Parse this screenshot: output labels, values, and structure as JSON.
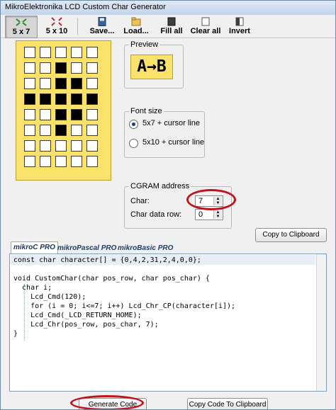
{
  "window": {
    "title": "MikroElektronika LCD Custom Char Generator"
  },
  "toolbar": {
    "size_5x7": "5 x 7",
    "size_5x10": "5 x 10",
    "save": "Save...",
    "load": "Load...",
    "fill_all": "Fill all",
    "clear_all": "Clear all",
    "invert": "Invert"
  },
  "grid": {
    "rows": 8,
    "cols": 5,
    "on_cells": [
      [
        1,
        2
      ],
      [
        2,
        2
      ],
      [
        2,
        3
      ],
      [
        3,
        0
      ],
      [
        3,
        1
      ],
      [
        3,
        2
      ],
      [
        3,
        3
      ],
      [
        3,
        4
      ],
      [
        4,
        2
      ],
      [
        4,
        3
      ],
      [
        5,
        2
      ]
    ]
  },
  "preview": {
    "legend": "Preview",
    "text": "A→B"
  },
  "font_size": {
    "legend": "Font size",
    "option_5x7": "5x7 + cursor line",
    "option_5x10": "5x10 + cursor line",
    "selected": "5x7"
  },
  "cgram": {
    "legend": "CGRAM address",
    "char_label": "Char:",
    "char_value": "7",
    "row_label": "Char data row:",
    "row_value": "0"
  },
  "buttons": {
    "copy_clipboard": "Copy to Clipboard",
    "generate_code": "Generate Code",
    "copy_code_clipboard": "Copy Code To Clipboard"
  },
  "tabs": {
    "mikroc": "mikroC PRO",
    "mikropascal": "mikroPascal PRO",
    "mikrobasic": "mikroBasic PRO"
  },
  "code": {
    "line1": "const char character[] = {0,4,2,31,2,4,0,0};",
    "line2": "",
    "line3": "void CustomChar(char pos_row, char pos_char) {",
    "line4": "  char i;",
    "line5": "    Lcd_Cmd(120);",
    "line6": "    for (i = 0; i<=7; i++) Lcd_Chr_CP(character[i]);",
    "line7": "    Lcd_Cmd(_LCD_RETURN_HOME);",
    "line8": "    Lcd_Chr(pos_row, pos_char, 7);",
    "line9": "}"
  },
  "colors": {
    "lcd_yellow": "#fbe36b",
    "highlight_red": "#c0141e"
  },
  "icons": [
    "app-icon",
    "size-5x7-icon",
    "size-5x10-icon",
    "save-icon",
    "load-icon",
    "fill-all-icon",
    "clear-all-icon",
    "invert-icon",
    "spin-arrows-icon"
  ]
}
